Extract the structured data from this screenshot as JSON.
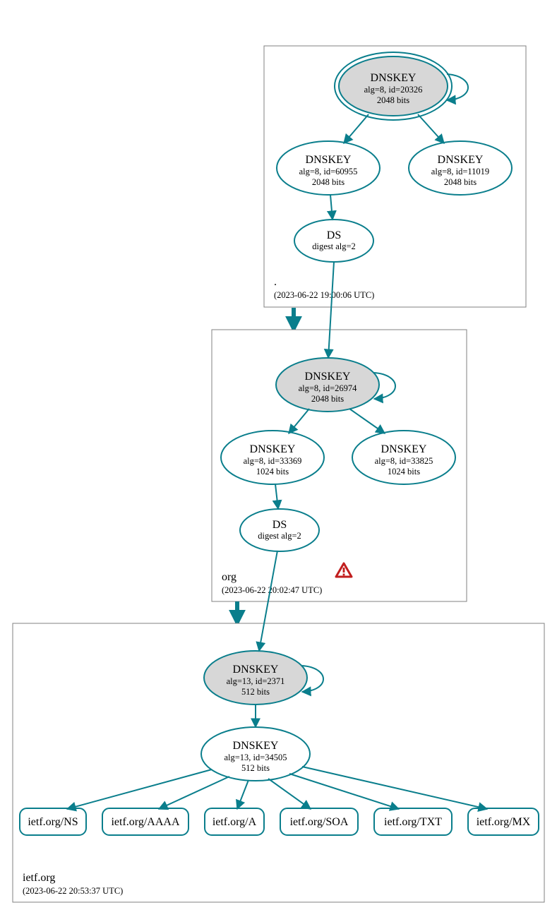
{
  "colors": {
    "accent": "#0a7e8c",
    "node_fill_grey": "#d7d7d7",
    "box_stroke": "#808080",
    "warn": "#c11e1e"
  },
  "zones": {
    "root": {
      "name": ".",
      "timestamp": "(2023-06-22 19:00:06 UTC)"
    },
    "org": {
      "name": "org",
      "timestamp": "(2023-06-22 20:02:47 UTC)"
    },
    "ietf": {
      "name": "ietf.org",
      "timestamp": "(2023-06-22 20:53:37 UTC)"
    }
  },
  "nodes": {
    "root_ksk": {
      "title": "DNSKEY",
      "line2": "alg=8, id=20326",
      "line3": "2048 bits"
    },
    "root_zsk1": {
      "title": "DNSKEY",
      "line2": "alg=8, id=60955",
      "line3": "2048 bits"
    },
    "root_zsk2": {
      "title": "DNSKEY",
      "line2": "alg=8, id=11019",
      "line3": "2048 bits"
    },
    "root_ds": {
      "title": "DS",
      "line2": "digest alg=2"
    },
    "org_ksk": {
      "title": "DNSKEY",
      "line2": "alg=8, id=26974",
      "line3": "2048 bits"
    },
    "org_zsk1": {
      "title": "DNSKEY",
      "line2": "alg=8, id=33369",
      "line3": "1024 bits"
    },
    "org_zsk2": {
      "title": "DNSKEY",
      "line2": "alg=8, id=33825",
      "line3": "1024 bits"
    },
    "org_ds": {
      "title": "DS",
      "line2": "digest alg=2"
    },
    "ietf_ksk": {
      "title": "DNSKEY",
      "line2": "alg=13, id=2371",
      "line3": "512 bits"
    },
    "ietf_zsk": {
      "title": "DNSKEY",
      "line2": "alg=13, id=34505",
      "line3": "512 bits"
    }
  },
  "rrs": {
    "ns": "ietf.org/NS",
    "aaaa": "ietf.org/AAAA",
    "a": "ietf.org/A",
    "soa": "ietf.org/SOA",
    "txt": "ietf.org/TXT",
    "mx": "ietf.org/MX"
  },
  "icons": {
    "warning": "warning-icon"
  }
}
